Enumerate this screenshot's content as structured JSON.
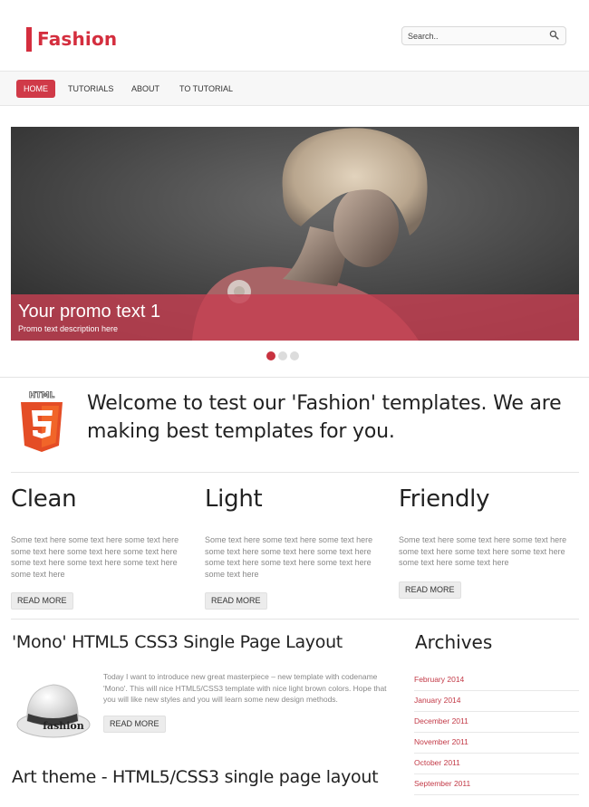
{
  "brand": {
    "name": "Fashion",
    "accent": "#d42e3e"
  },
  "search": {
    "placeholder": "Search.."
  },
  "nav": [
    {
      "label": "HOME",
      "active": true
    },
    {
      "label": "TUTORIALS",
      "active": false
    },
    {
      "label": "ABOUT",
      "active": false
    },
    {
      "label": "TO TUTORIAL",
      "active": false
    }
  ],
  "slider": {
    "title": "Your promo text 1",
    "description": "Promo text description here",
    "slide_count": 3,
    "active_slide": 1
  },
  "welcome": {
    "text": "Welcome to test our 'Fashion' templates. We are making best templates for you.",
    "badge_text": "HTML"
  },
  "features": [
    {
      "title": "Clean",
      "text": "Some text here some text here some text here some text here some text here some text here some text here some text here some text here some text here",
      "button": "READ MORE"
    },
    {
      "title": "Light",
      "text": "Some text here some text here some text here some text here some text here some text here some text here some text here some text here some text here",
      "button": "READ MORE"
    },
    {
      "title": "Friendly",
      "text": "Some text here some text here some text here some text here some text here some text here some text here some text here",
      "button": "READ MORE"
    }
  ],
  "post": {
    "title": "'Mono' HTML5 CSS3 Single Page Layout",
    "text": "Today I want to introduce new great masterpiece – new template with codename 'Mono'. This will nice HTML5/CSS3 template with nice light brown colors. Hope that you will like new styles and you will learn some new design methods.",
    "button": "READ MORE",
    "image_text": "fashion"
  },
  "post2": {
    "title": "Art theme - HTML5/CSS3 single page layout"
  },
  "archives": {
    "title": "Archives",
    "items": [
      "February 2014",
      "January 2014",
      "December 2011",
      "November 2011",
      "October 2011",
      "September 2011"
    ]
  }
}
